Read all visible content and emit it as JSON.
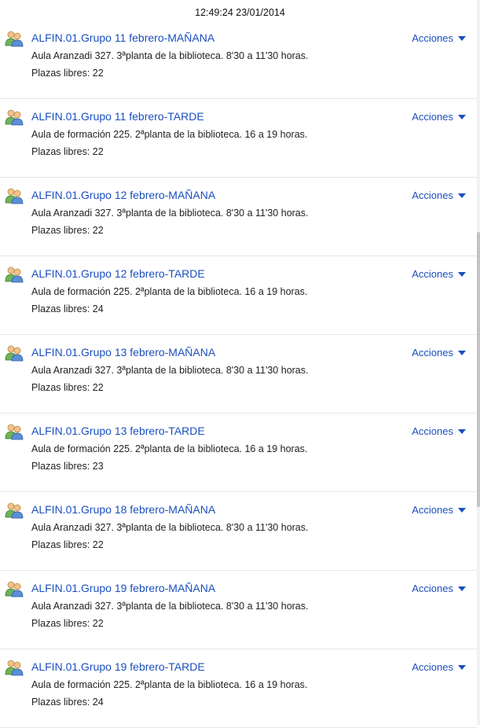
{
  "header": {
    "clock": "12:49:24 23/01/2014"
  },
  "actions_label": "Acciones",
  "items": [
    {
      "title": "ALFIN.01.Grupo 11 febrero-MAÑANA",
      "description": "Aula Aranzadi 327. 3ªplanta de la biblioteca. 8'30 a 11'30 horas.",
      "places": "Plazas libres: 22"
    },
    {
      "title": "ALFIN.01.Grupo 11 febrero-TARDE",
      "description": "Aula de formación 225. 2ªplanta de la biblioteca. 16 a 19 horas.",
      "places": "Plazas libres: 22"
    },
    {
      "title": "ALFIN.01.Grupo 12 febrero-MAÑANA",
      "description": "Aula Aranzadi 327. 3ªplanta de la biblioteca. 8'30 a 11'30 horas.",
      "places": "Plazas libres: 22"
    },
    {
      "title": "ALFIN.01.Grupo 12 febrero-TARDE",
      "description": "Aula de formación 225. 2ªplanta de la biblioteca. 16 a 19 horas.",
      "places": "Plazas libres: 24"
    },
    {
      "title": "ALFIN.01.Grupo 13 febrero-MAÑANA",
      "description": "Aula Aranzadi 327. 3ªplanta de la biblioteca. 8'30 a 11'30 horas.",
      "places": "Plazas libres: 22"
    },
    {
      "title": "ALFIN.01.Grupo 13 febrero-TARDE",
      "description": "Aula de formación 225. 2ªplanta de la biblioteca. 16 a 19 horas.",
      "places": "Plazas libres: 23"
    },
    {
      "title": "ALFIN.01.Grupo 18 febrero-MAÑANA",
      "description": "Aula Aranzadi 327. 3ªplanta de la biblioteca. 8'30 a 11'30 horas.",
      "places": "Plazas libres: 22"
    },
    {
      "title": "ALFIN.01.Grupo 19 febrero-MAÑANA",
      "description": "Aula Aranzadi 327. 3ªplanta de la biblioteca. 8'30 a 11'30 horas.",
      "places": "Plazas libres: 22"
    },
    {
      "title": "ALFIN.01.Grupo 19 febrero-TARDE",
      "description": "Aula de formación 225. 2ªplanta de la biblioteca. 16 a 19 horas.",
      "places": "Plazas libres: 24"
    }
  ],
  "icons": {
    "item_icon": "group-users-icon",
    "actions_icon": "caret-down-icon"
  },
  "colors": {
    "link": "#1a4fbf",
    "text": "#222222",
    "divider": "#e6e6e6"
  }
}
